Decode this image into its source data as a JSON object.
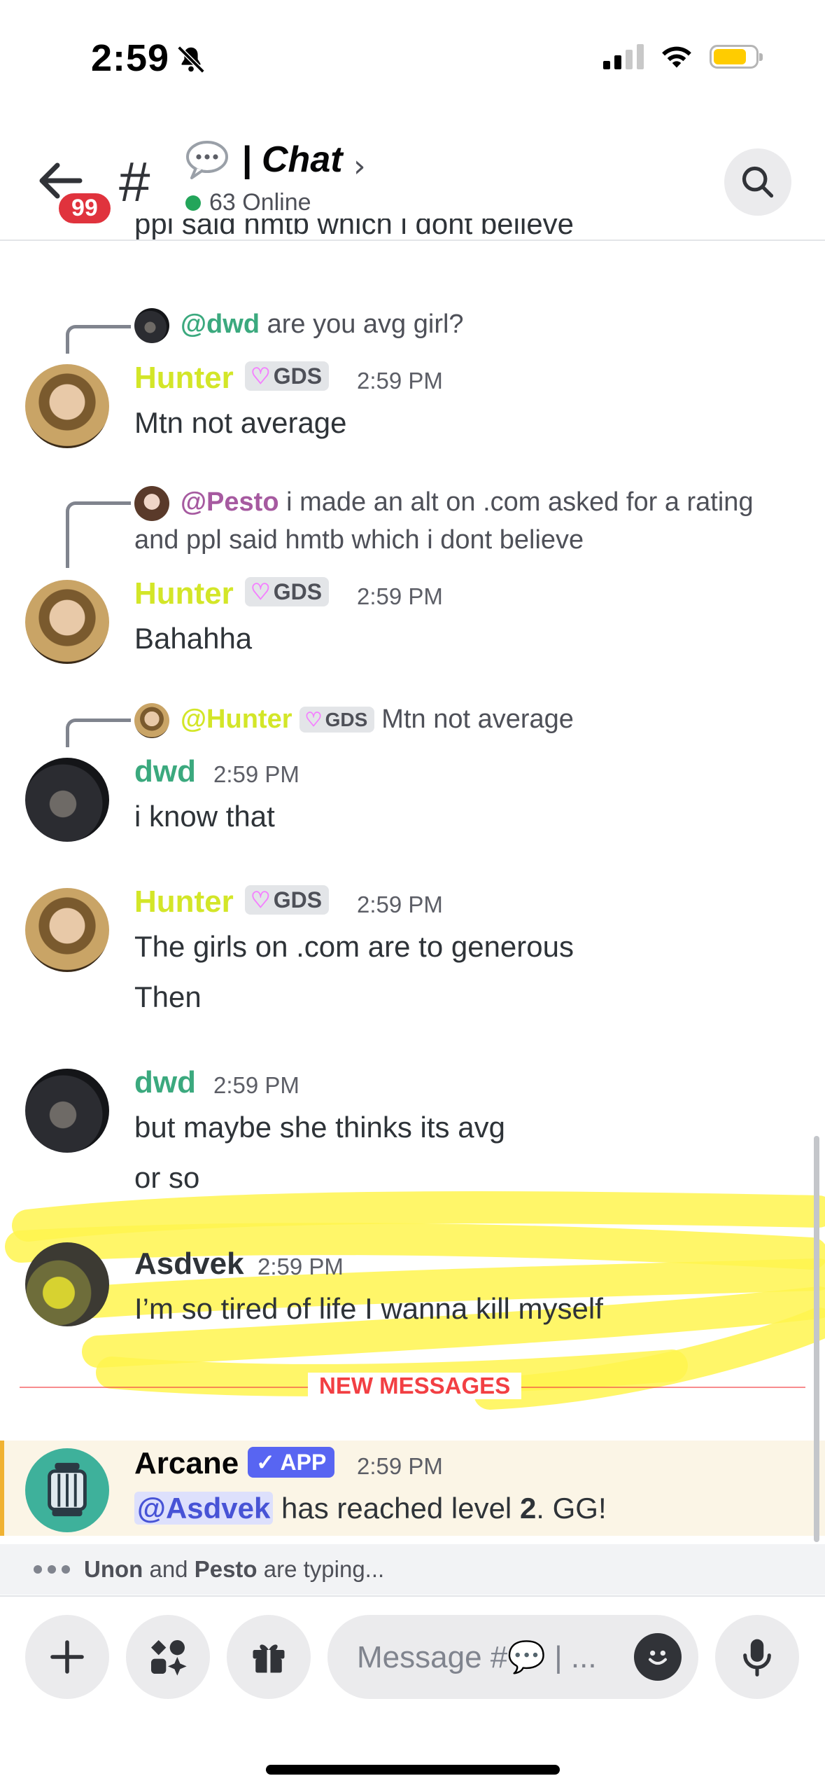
{
  "status_bar": {
    "time": "2:59"
  },
  "header": {
    "back_badge": "99",
    "channel_prefix": "#",
    "channel_name": "| Chat",
    "chevron": "›",
    "online": "63 Online"
  },
  "top_cut_text": "ppl said hmtb which i dont believe",
  "messages": [
    {
      "reply": {
        "mention": "@dwd",
        "text": "are you avg girl?"
      },
      "author": "Hunter",
      "tag": "GDS",
      "time": "2:59 PM",
      "lines": [
        "Mtn not average"
      ]
    },
    {
      "reply": {
        "mention": "@Pesto",
        "text": "i made an alt on .com asked for a rating",
        "text2": "and ppl said hmtb which i dont believe"
      },
      "author": "Hunter",
      "tag": "GDS",
      "time": "2:59 PM",
      "lines": [
        "Bahahha"
      ]
    },
    {
      "reply": {
        "mention": "@Hunter",
        "tag": "GDS",
        "text": "Mtn not average"
      },
      "author": "dwd",
      "time": "2:59 PM",
      "lines": [
        "i know that"
      ]
    },
    {
      "author": "Hunter",
      "tag": "GDS",
      "time": "2:59 PM",
      "lines": [
        "The girls on .com are to generous",
        "Then"
      ]
    },
    {
      "author": "dwd",
      "time": "2:59 PM",
      "lines": [
        "but maybe she thinks its avg",
        "or so"
      ]
    },
    {
      "author": "Asdvek",
      "time": "2:59 PM",
      "lines": [
        "I’m so tired of life I wanna kill myself"
      ]
    }
  ],
  "new_messages_label": "NEW MESSAGES",
  "app_message": {
    "author": "Arcane",
    "tag": "✓ APP",
    "time": "2:59 PM",
    "mention": "@Asdvek",
    "text_before": " has reached level ",
    "level": "2",
    "text_after": ". GG!"
  },
  "typing": {
    "user1": "Unon",
    "and": " and ",
    "user2": "Pesto",
    "suffix": " are typing..."
  },
  "composer": {
    "placeholder": "Message #💬 | ..."
  },
  "colors": {
    "hunter": "#d3e628",
    "dwd": "#3ba97e",
    "pesto": "#a65aa0",
    "asdvek": "#2e3338",
    "online_dot": "#23a55a",
    "badge": "#e0333d",
    "new_messages": "#f23f43",
    "app_tag": "#5865f2",
    "highlight": "#fff44f"
  },
  "icons": [
    "back-arrow-icon",
    "bell-slash-icon",
    "signal-icon",
    "wifi-icon",
    "battery-icon",
    "speech-bubble-icon",
    "search-icon",
    "plus-icon",
    "apps-icon",
    "gift-icon",
    "emoji-icon",
    "microphone-icon"
  ]
}
